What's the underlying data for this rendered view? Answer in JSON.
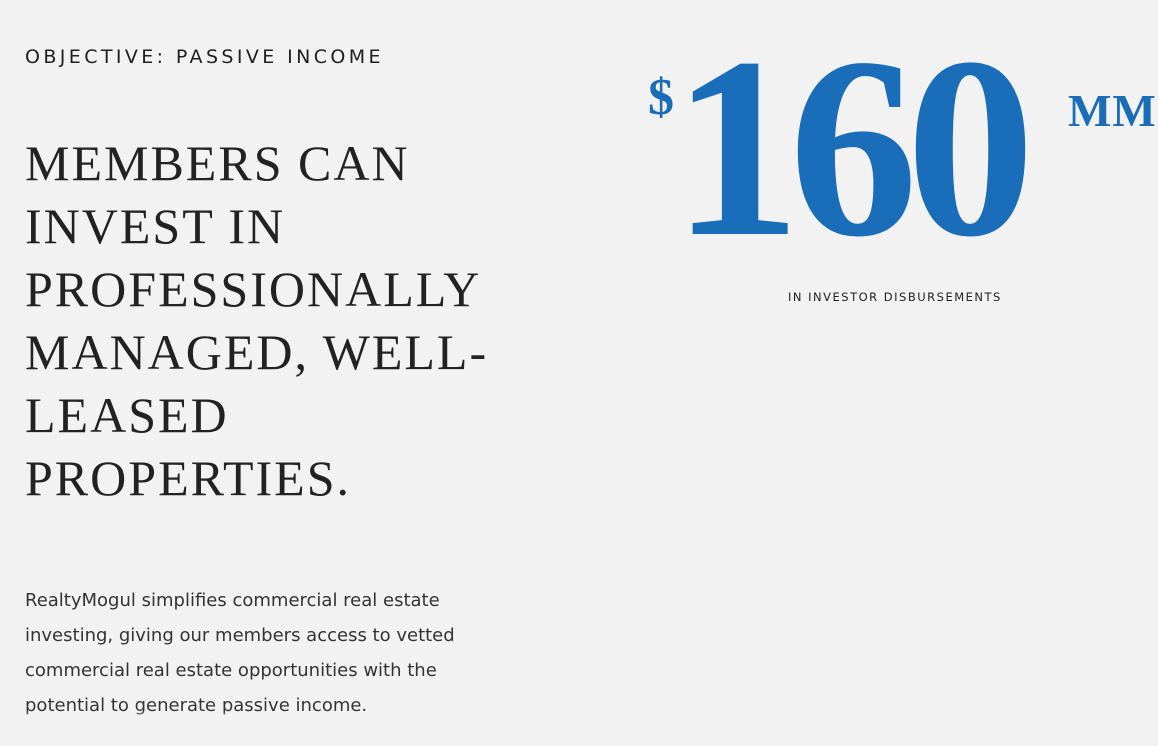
{
  "section": {
    "eyebrow": "OBJECTIVE: PASSIVE INCOME",
    "headline_lines": [
      "MEMBERS CAN",
      "INVEST IN",
      "PROFESSIONALLY",
      "MANAGED, WELL-",
      "LEASED",
      "PROPERTIES."
    ],
    "body_lines": [
      "RealtyMogul simplifies commercial real estate",
      "investing, giving our members access to vetted",
      "commercial real estate opportunities with the",
      "potential to generate passive income."
    ]
  },
  "stat": {
    "currency": "$",
    "value": "160",
    "unit": "MM",
    "caption": "IN INVESTOR DISBURSEMENTS"
  },
  "colors": {
    "background": "#f2f2f2",
    "accent": "#1a6db8",
    "text": "#222222"
  }
}
